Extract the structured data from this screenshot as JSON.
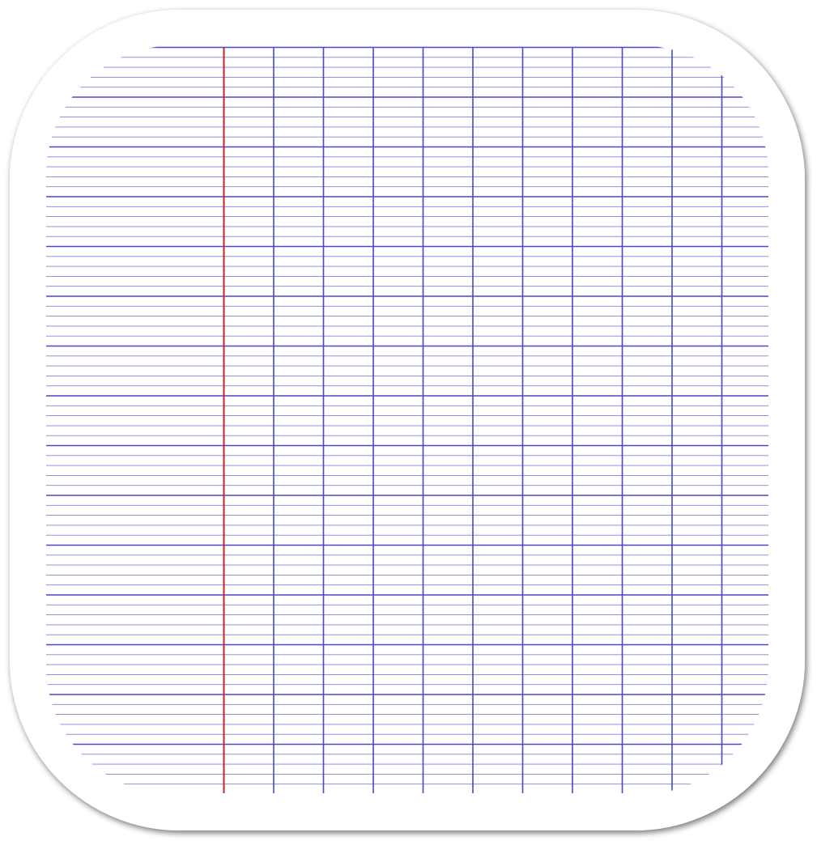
{
  "icon": {
    "name": "graph-paper-icon",
    "colors": {
      "background": "#ffffff",
      "paper": "#ffffff",
      "shadow": "#000000",
      "grid_major": "#4848c8",
      "grid_minor": "#8080dc",
      "margin_line": "#c02828"
    },
    "grid": {
      "margin_columns": 1,
      "grid_columns": 10,
      "major_rows": 15,
      "minor_lines_per_major": 4
    }
  }
}
